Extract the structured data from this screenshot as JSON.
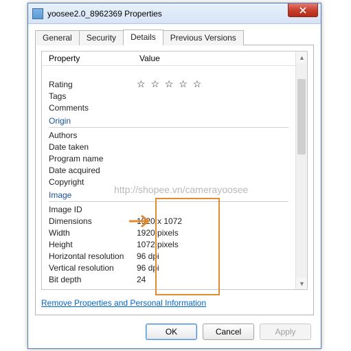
{
  "window": {
    "title": "yoosee2.0_8962369 Properties",
    "close_label": "Close"
  },
  "tabs": {
    "items": [
      {
        "label": "General"
      },
      {
        "label": "Security"
      },
      {
        "label": "Details"
      },
      {
        "label": "Previous Versions"
      }
    ],
    "active_index": 2
  },
  "list": {
    "header_property": "Property",
    "header_value": "Value",
    "sections": [
      {
        "name": null,
        "rows": [
          {
            "prop": "",
            "val": ""
          },
          {
            "prop": "Rating",
            "val": "☆ ☆ ☆ ☆ ☆",
            "stars": true
          },
          {
            "prop": "Tags",
            "val": ""
          },
          {
            "prop": "Comments",
            "val": ""
          }
        ]
      },
      {
        "name": "Origin",
        "rows": [
          {
            "prop": "Authors",
            "val": ""
          },
          {
            "prop": "Date taken",
            "val": ""
          },
          {
            "prop": "Program name",
            "val": ""
          },
          {
            "prop": "Date acquired",
            "val": ""
          },
          {
            "prop": "Copyright",
            "val": ""
          }
        ]
      },
      {
        "name": "Image",
        "rows": [
          {
            "prop": "Image ID",
            "val": ""
          },
          {
            "prop": "Dimensions",
            "val": "1920 x 1072"
          },
          {
            "prop": "Width",
            "val": "1920 pixels"
          },
          {
            "prop": "Height",
            "val": "1072 pixels"
          },
          {
            "prop": "Horizontal resolution",
            "val": "96 dpi"
          },
          {
            "prop": "Vertical resolution",
            "val": "96 dpi"
          },
          {
            "prop": "Bit depth",
            "val": "24"
          }
        ]
      }
    ]
  },
  "link": "Remove Properties and Personal Information",
  "buttons": {
    "ok": "OK",
    "cancel": "Cancel",
    "apply": "Apply"
  },
  "watermark": "http://shopee.vn/camerayoosee"
}
